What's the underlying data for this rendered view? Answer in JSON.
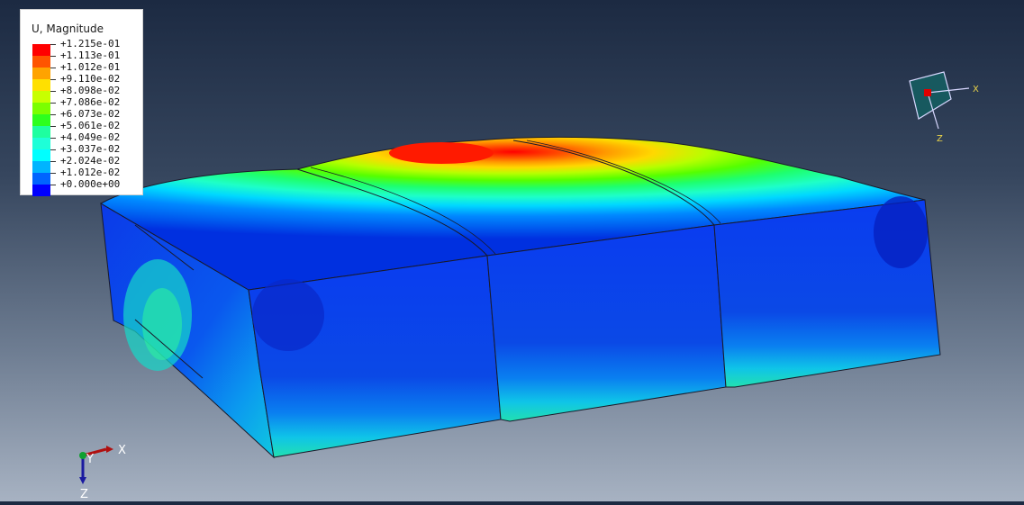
{
  "legend": {
    "title": "U, Magnitude",
    "labels": [
      "+1.215e-01",
      "+1.113e-01",
      "+1.012e-01",
      "+9.110e-02",
      "+8.098e-02",
      "+7.086e-02",
      "+6.073e-02",
      "+5.061e-02",
      "+4.049e-02",
      "+3.037e-02",
      "+2.024e-02",
      "+1.012e-02",
      "+0.000e+00"
    ],
    "colors": [
      "#ff0000",
      "#ff5400",
      "#ffa300",
      "#ffe000",
      "#c8ff00",
      "#7bff00",
      "#2dff1e",
      "#1effa0",
      "#1effd8",
      "#00ffff",
      "#00b4ff",
      "#0064ff",
      "#0000ff"
    ]
  },
  "triad_view": {
    "x_label": "X",
    "z_label": "Z"
  },
  "triad_global": {
    "x_label": "X",
    "y_label": "Y",
    "z_label": "Z"
  },
  "colors": {
    "background_top": "#1c2a42",
    "background_bottom": "#a7b2c2",
    "mesh_edge": "#1a1a2a"
  }
}
